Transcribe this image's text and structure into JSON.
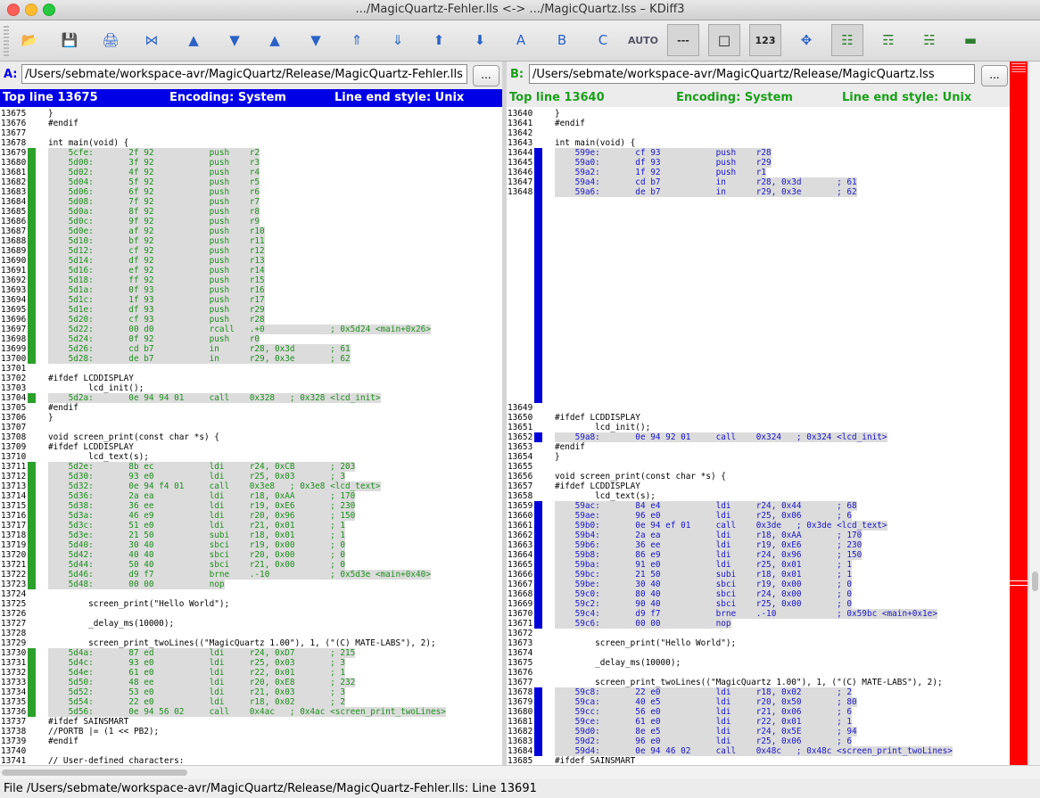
{
  "window": {
    "title": ".../MagicQuartz-Fehler.lls <-> .../MagicQuartz.lss – KDiff3"
  },
  "toolbar": {
    "buttons": [
      {
        "name": "open-icon",
        "glyph": "📂"
      },
      {
        "name": "save-icon",
        "glyph": "💾"
      },
      {
        "name": "print-icon",
        "glyph": "🖨"
      },
      {
        "name": "go-current-delta-icon",
        "glyph": "⋈"
      },
      {
        "name": "go-top-icon",
        "glyph": "▲"
      },
      {
        "name": "go-bottom-icon",
        "glyph": "▼"
      },
      {
        "name": "go-prev-delta-icon",
        "glyph": "▲"
      },
      {
        "name": "go-next-delta-icon",
        "glyph": "▼"
      },
      {
        "name": "go-prev-conflict-icon",
        "glyph": "⇑"
      },
      {
        "name": "go-next-conflict-icon",
        "glyph": "⇓"
      },
      {
        "name": "go-prev-unsolved-icon",
        "glyph": "⬆"
      },
      {
        "name": "go-next-unsolved-icon",
        "glyph": "⬇"
      },
      {
        "name": "select-a-icon",
        "glyph": "A"
      },
      {
        "name": "select-b-icon",
        "glyph": "B"
      },
      {
        "name": "select-c-icon",
        "glyph": "C"
      },
      {
        "name": "auto-solve-icon",
        "glyph": "AUTO"
      },
      {
        "name": "show-whitespace-icon",
        "glyph": "---"
      },
      {
        "name": "show-whitespace-chars-icon",
        "glyph": "□"
      },
      {
        "name": "show-line-numbers-icon",
        "glyph": "123"
      },
      {
        "name": "show-diff-icon",
        "glyph": "✥"
      },
      {
        "name": "toggle-window-a-icon",
        "glyph": "☷"
      },
      {
        "name": "toggle-window-b-icon",
        "glyph": "☶"
      },
      {
        "name": "toggle-window-c-icon",
        "glyph": "☵"
      },
      {
        "name": "toggle-split-icon",
        "glyph": "▬"
      }
    ]
  },
  "paneA": {
    "label": "A:",
    "path": "/Users/sebmate/workspace-avr/MagicQuartz/Release/MagicQuartz-Fehler.lls",
    "browse": "...",
    "top_line": "Top line 13675",
    "encoding": "Encoding: System",
    "line_end": "Line end style: Unix",
    "lines": [
      [
        "13675",
        "",
        "}"
      ],
      [
        "13676",
        "",
        "#endif"
      ],
      [
        "13677",
        "",
        ""
      ],
      [
        "13678",
        "",
        "int main(void) {"
      ],
      [
        "13679",
        "g",
        "    5cfe:       2f 92           push    r2"
      ],
      [
        "13680",
        "g",
        "    5d00:       3f 92           push    r3"
      ],
      [
        "13681",
        "g",
        "    5d02:       4f 92           push    r4"
      ],
      [
        "13682",
        "g",
        "    5d04:       5f 92           push    r5"
      ],
      [
        "13683",
        "g",
        "    5d06:       6f 92           push    r6"
      ],
      [
        "13684",
        "g",
        "    5d08:       7f 92           push    r7"
      ],
      [
        "13685",
        "g",
        "    5d0a:       8f 92           push    r8"
      ],
      [
        "13686",
        "g",
        "    5d0c:       9f 92           push    r9"
      ],
      [
        "13687",
        "g",
        "    5d0e:       af 92           push    r10"
      ],
      [
        "13688",
        "g",
        "    5d10:       bf 92           push    r11"
      ],
      [
        "13689",
        "g",
        "    5d12:       cf 92           push    r12"
      ],
      [
        "13690",
        "g",
        "    5d14:       df 92           push    r13"
      ],
      [
        "13691",
        "g",
        "    5d16:       ef 92           push    r14"
      ],
      [
        "13692",
        "g",
        "    5d18:       ff 92           push    r15"
      ],
      [
        "13693",
        "g",
        "    5d1a:       0f 93           push    r16"
      ],
      [
        "13694",
        "g",
        "    5d1c:       1f 93           push    r17"
      ],
      [
        "13695",
        "g",
        "    5d1e:       df 93           push    r29"
      ],
      [
        "13696",
        "g",
        "    5d20:       cf 93           push    r28"
      ],
      [
        "13697",
        "g",
        "    5d22:       00 d0           rcall   .+0             ; 0x5d24 <main+0x26>"
      ],
      [
        "13698",
        "g",
        "    5d24:       0f 92           push    r0"
      ],
      [
        "13699",
        "g",
        "    5d26:       cd b7           in      r28, 0x3d       ; 61"
      ],
      [
        "13700",
        "g",
        "    5d28:       de b7           in      r29, 0x3e       ; 62"
      ],
      [
        "13701",
        "",
        ""
      ],
      [
        "13702",
        "",
        "#ifdef LCDDISPLAY"
      ],
      [
        "13703",
        "",
        "        lcd_init();"
      ],
      [
        "13704",
        "g",
        "    5d2a:       0e 94 94 01     call    0x328   ; 0x328 <lcd_init>"
      ],
      [
        "13705",
        "",
        "#endif"
      ],
      [
        "13706",
        "",
        "}"
      ],
      [
        "13707",
        "",
        ""
      ],
      [
        "13708",
        "",
        "void screen_print(const char *s) {"
      ],
      [
        "13709",
        "",
        "#ifdef LCDDISPLAY"
      ],
      [
        "13710",
        "",
        "        lcd_text(s);"
      ],
      [
        "13711",
        "g",
        "    5d2e:       8b ec           ldi     r24, 0xCB       ; 203"
      ],
      [
        "13712",
        "g",
        "    5d30:       93 e0           ldi     r25, 0x03       ; 3"
      ],
      [
        "13713",
        "g",
        "    5d32:       0e 94 f4 01     call    0x3e8   ; 0x3e8 <lcd_text>"
      ],
      [
        "13714",
        "g",
        "    5d36:       2a ea           ldi     r18, 0xAA       ; 170"
      ],
      [
        "13715",
        "g",
        "    5d38:       36 ee           ldi     r19, 0xE6       ; 230"
      ],
      [
        "13716",
        "g",
        "    5d3a:       46 e9           ldi     r20, 0x96       ; 150"
      ],
      [
        "13717",
        "g",
        "    5d3c:       51 e0           ldi     r21, 0x01       ; 1"
      ],
      [
        "13718",
        "g",
        "    5d3e:       21 50           subi    r18, 0x01       ; 1"
      ],
      [
        "13719",
        "g",
        "    5d40:       30 40           sbci    r19, 0x00       ; 0"
      ],
      [
        "13720",
        "g",
        "    5d42:       40 40           sbci    r20, 0x00       ; 0"
      ],
      [
        "13721",
        "g",
        "    5d44:       50 40           sbci    r21, 0x00       ; 0"
      ],
      [
        "13722",
        "g",
        "    5d46:       d9 f7           brne    .-10            ; 0x5d3e <main+0x40>"
      ],
      [
        "13723",
        "g",
        "    5d48:       00 00           nop"
      ],
      [
        "13724",
        "",
        ""
      ],
      [
        "13725",
        "",
        "        screen_print(\"Hello World\");"
      ],
      [
        "13726",
        "",
        ""
      ],
      [
        "13727",
        "",
        "        _delay_ms(10000);"
      ],
      [
        "13728",
        "",
        ""
      ],
      [
        "13729",
        "",
        "        screen_print_twoLines((\"MagicQuartz 1.00\"), 1, (\"(C) MATE-LABS\"), 2);"
      ],
      [
        "13730",
        "g",
        "    5d4a:       87 ed           ldi     r24, 0xD7       ; 215"
      ],
      [
        "13731",
        "g",
        "    5d4c:       93 e0           ldi     r25, 0x03       ; 3"
      ],
      [
        "13732",
        "g",
        "    5d4e:       61 e0           ldi     r22, 0x01       ; 1"
      ],
      [
        "13733",
        "g",
        "    5d50:       48 ee           ldi     r20, 0xE8       ; 232"
      ],
      [
        "13734",
        "g",
        "    5d52:       53 e0           ldi     r21, 0x03       ; 3"
      ],
      [
        "13735",
        "g",
        "    5d54:       22 e0           ldi     r18, 0x02       ; 2"
      ],
      [
        "13736",
        "g",
        "    5d56:       0e 94 56 02     call    0x4ac   ; 0x4ac <screen_print_twoLines>"
      ],
      [
        "13737",
        "",
        "#ifdef SAINSMART"
      ],
      [
        "13738",
        "",
        "//PORTB |= (1 << PB2);"
      ],
      [
        "13739",
        "",
        "#endif"
      ],
      [
        "13740",
        "",
        ""
      ],
      [
        "13741",
        "",
        "// User-defined characters:"
      ]
    ]
  },
  "paneB": {
    "label": "B:",
    "path": "/Users/sebmate/workspace-avr/MagicQuartz/Release/MagicQuartz.lss",
    "browse": "...",
    "top_line": "Top line 13640",
    "encoding": "Encoding: System",
    "line_end": "Line end style: Unix",
    "lines": [
      [
        "13640",
        "",
        "}"
      ],
      [
        "13641",
        "",
        "#endif"
      ],
      [
        "13642",
        "",
        ""
      ],
      [
        "13643",
        "",
        "int main(void) {"
      ],
      [
        "13644",
        "b",
        "    599e:       cf 93           push    r28"
      ],
      [
        "13645",
        "b",
        "    59a0:       df 93           push    r29"
      ],
      [
        "13646",
        "b",
        "    59a2:       1f 92           push    r1"
      ],
      [
        "13647",
        "b",
        "    59a4:       cd b7           in      r28, 0x3d       ; 61"
      ],
      [
        "13648",
        "b",
        "    59a6:       de b7           in      r29, 0x3e       ; 62"
      ],
      [
        "",
        "gap",
        ""
      ],
      [
        "",
        "gap",
        ""
      ],
      [
        "",
        "gap",
        ""
      ],
      [
        "",
        "gap",
        ""
      ],
      [
        "",
        "gap",
        ""
      ],
      [
        "",
        "gap",
        ""
      ],
      [
        "",
        "gap",
        ""
      ],
      [
        "",
        "gap",
        ""
      ],
      [
        "",
        "gap",
        ""
      ],
      [
        "",
        "gap",
        ""
      ],
      [
        "",
        "gap",
        ""
      ],
      [
        "",
        "gap",
        ""
      ],
      [
        "",
        "gap",
        ""
      ],
      [
        "",
        "gap",
        ""
      ],
      [
        "",
        "gap",
        ""
      ],
      [
        "",
        "gap",
        ""
      ],
      [
        "",
        "gap",
        ""
      ],
      [
        "",
        "gap",
        ""
      ],
      [
        "",
        "gap",
        ""
      ],
      [
        "",
        "gap",
        ""
      ],
      [
        "",
        "gap",
        ""
      ],
      [
        "13649",
        "",
        ""
      ],
      [
        "13650",
        "",
        "#ifdef LCDDISPLAY"
      ],
      [
        "13651",
        "",
        "        lcd_init();"
      ],
      [
        "13652",
        "b",
        "    59a8:       0e 94 92 01     call    0x324   ; 0x324 <lcd_init>"
      ],
      [
        "13653",
        "",
        "#endif"
      ],
      [
        "13654",
        "",
        "}"
      ],
      [
        "13655",
        "",
        ""
      ],
      [
        "13656",
        "",
        "void screen_print(const char *s) {"
      ],
      [
        "13657",
        "",
        "#ifdef LCDDISPLAY"
      ],
      [
        "13658",
        "",
        "        lcd_text(s);"
      ],
      [
        "13659",
        "b",
        "    59ac:       84 e4           ldi     r24, 0x44       ; 68"
      ],
      [
        "13660",
        "b",
        "    59ae:       96 e0           ldi     r25, 0x06       ; 6"
      ],
      [
        "13661",
        "b",
        "    59b0:       0e 94 ef 01     call    0x3de   ; 0x3de <lcd_text>"
      ],
      [
        "13662",
        "b",
        "    59b4:       2a ea           ldi     r18, 0xAA       ; 170"
      ],
      [
        "13663",
        "b",
        "    59b6:       36 ee           ldi     r19, 0xE6       ; 230"
      ],
      [
        "13664",
        "b",
        "    59b8:       86 e9           ldi     r24, 0x96       ; 150"
      ],
      [
        "13665",
        "b",
        "    59ba:       91 e0           ldi     r25, 0x01       ; 1"
      ],
      [
        "13666",
        "b",
        "    59bc:       21 50           subi    r18, 0x01       ; 1"
      ],
      [
        "13667",
        "b",
        "    59be:       30 40           sbci    r19, 0x00       ; 0"
      ],
      [
        "13668",
        "b",
        "    59c0:       80 40           sbci    r24, 0x00       ; 0"
      ],
      [
        "13669",
        "b",
        "    59c2:       90 40           sbci    r25, 0x00       ; 0"
      ],
      [
        "13670",
        "b",
        "    59c4:       d9 f7           brne    .-10            ; 0x59bc <main+0x1e>"
      ],
      [
        "13671",
        "b",
        "    59c6:       00 00           nop"
      ],
      [
        "13672",
        "",
        ""
      ],
      [
        "13673",
        "",
        "        screen_print(\"Hello World\");"
      ],
      [
        "13674",
        "",
        ""
      ],
      [
        "13675",
        "",
        "        _delay_ms(10000);"
      ],
      [
        "13676",
        "",
        ""
      ],
      [
        "13677",
        "",
        "        screen_print_twoLines((\"MagicQuartz 1.00\"), 1, (\"(C) MATE-LABS\"), 2);"
      ],
      [
        "13678",
        "b",
        "    59c8:       22 e0           ldi     r18, 0x02       ; 2"
      ],
      [
        "13679",
        "b",
        "    59ca:       40 e5           ldi     r20, 0x50       ; 80"
      ],
      [
        "13680",
        "b",
        "    59cc:       56 e0           ldi     r21, 0x06       ; 6"
      ],
      [
        "13681",
        "b",
        "    59ce:       61 e0           ldi     r22, 0x01       ; 1"
      ],
      [
        "13682",
        "b",
        "    59d0:       8e e5           ldi     r24, 0x5E       ; 94"
      ],
      [
        "13683",
        "b",
        "    59d2:       96 e0           ldi     r25, 0x06       ; 6"
      ],
      [
        "13684",
        "b",
        "    59d4:       0e 94 46 02     call    0x48c   ; 0x48c <screen_print_twoLines>"
      ],
      [
        "13685",
        "",
        "#ifdef SAINSMART"
      ],
      [
        "13686",
        "",
        "//PORTB |= (1 << PB2);"
      ],
      [
        "13687",
        "",
        "#endif"
      ],
      [
        "13688",
        "",
        ""
      ],
      [
        "13689",
        "",
        "// User-defined characters:"
      ]
    ]
  },
  "status": {
    "text": "File /Users/sebmate/workspace-avr/MagicQuartz/Release/MagicQuartz-Fehler.lls: Line 13691"
  },
  "colors": {
    "a_header_bg": "#0000e6",
    "b_header_text": "#1a9f1a",
    "a_mark": "#2ba02b",
    "b_mark": "#0000d8",
    "a_changed_text": "#1d8f1d",
    "b_changed_text": "#1818c8",
    "overview": "#ff0000"
  }
}
